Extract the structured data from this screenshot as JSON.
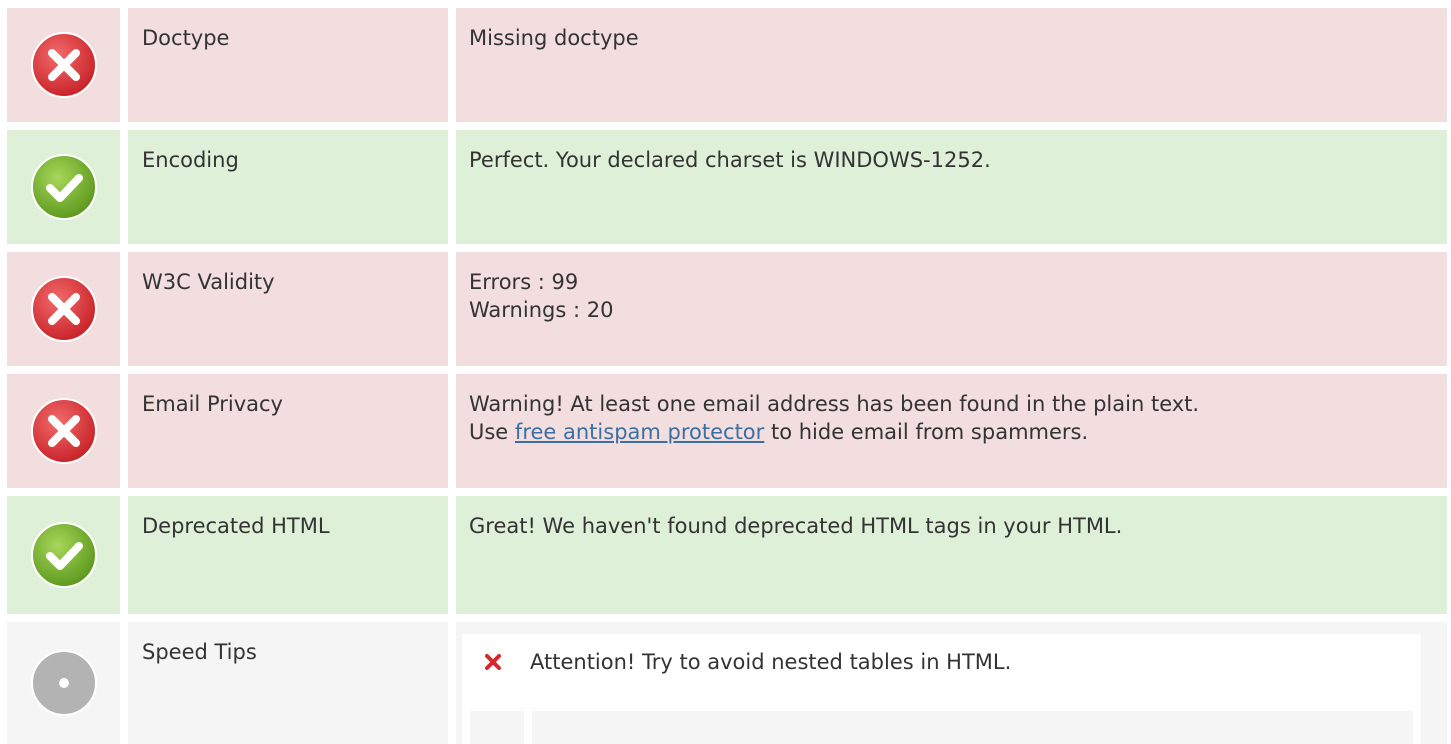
{
  "rows": [
    {
      "status": "fail",
      "icon": "error-x-icon",
      "label": "Doctype",
      "value_lines": [
        "Missing doctype"
      ]
    },
    {
      "status": "pass",
      "icon": "check-icon",
      "label": "Encoding",
      "value_lines": [
        "Perfect. Your declared charset is WINDOWS-1252."
      ]
    },
    {
      "status": "fail",
      "icon": "error-x-icon",
      "label": "W3C Validity",
      "value_lines": [
        "Errors : 99",
        "Warnings : 20"
      ]
    },
    {
      "status": "fail",
      "icon": "error-x-icon",
      "label": "Email Privacy",
      "value_line1": "Warning! At least one email address has been found in the plain text.",
      "value_prefix": "Use ",
      "value_link": "free antispam protector",
      "value_suffix": " to hide email from spammers."
    },
    {
      "status": "pass",
      "icon": "check-icon",
      "label": "Deprecated HTML",
      "value_lines": [
        "Great! We haven't found deprecated HTML tags in your HTML."
      ]
    },
    {
      "status": "info",
      "icon": "neutral-circle-icon",
      "label": "Speed Tips",
      "tips": [
        {
          "icon": "red-x-icon",
          "text": "Attention! Try to avoid nested tables in HTML."
        }
      ]
    }
  ],
  "colors": {
    "fail_bg": "#f2dede",
    "pass_bg": "#dff0d8",
    "info_bg": "#f5f5f5",
    "fail_icon": "#e23b3b",
    "pass_icon": "#7ab33b",
    "neutral_icon": "#b3b3b3",
    "link": "#3b6fa3"
  }
}
